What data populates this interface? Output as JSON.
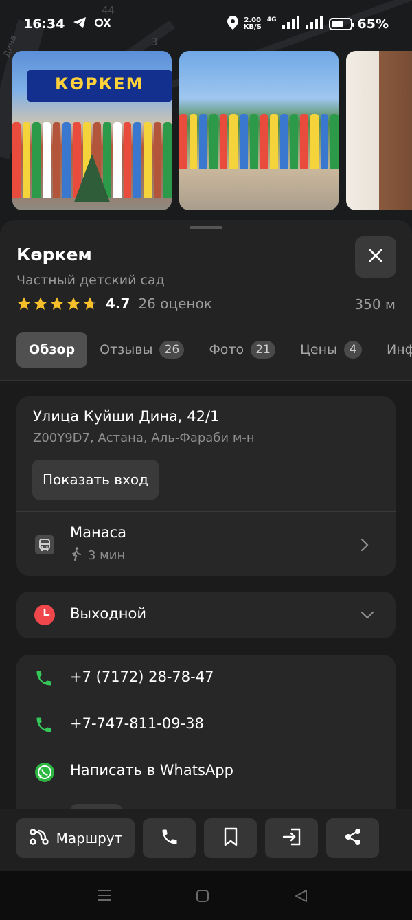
{
  "status_bar": {
    "time": "16:34",
    "net_speed_value": "2.00",
    "net_speed_unit": "KB/S",
    "net_type": "4G",
    "battery_percent": "65%",
    "battery_level": 0.65
  },
  "map": {
    "number_44": "44",
    "number_3": "3",
    "street_fragment": "Дина"
  },
  "photos": {
    "sign_text": "КӨРКЕМ"
  },
  "place": {
    "name": "Көркем",
    "category": "Частный детский сад",
    "rating": "4.7",
    "rating_stars": 4.7,
    "reviews_count": "26 оценок",
    "distance": "350 м"
  },
  "tabs": [
    {
      "label": "Обзор",
      "badge": ""
    },
    {
      "label": "Отзывы",
      "badge": "26"
    },
    {
      "label": "Фото",
      "badge": "21"
    },
    {
      "label": "Цены",
      "badge": "4"
    },
    {
      "label": "Инфо",
      "badge": ""
    }
  ],
  "address": {
    "street": "Улица Куйши Дина, 42/1",
    "details": "Z00Y9D7, Астана, Аль-Фараби м-н",
    "entry_button": "Показать вход"
  },
  "transit": {
    "stop_name": "Манаса",
    "walk_time": "3 мин"
  },
  "hours": {
    "status": "Выходной"
  },
  "contacts": {
    "phone1": "+7 (7172) 28-78-47",
    "phone2": "+7-747-811-09-38",
    "whatsapp": "Написать в WhatsApp"
  },
  "actions": {
    "route_label": "Маршрут"
  },
  "colors": {
    "accent_green": "#35c759",
    "accent_red": "#f0474c",
    "star": "#f7c02b",
    "whatsapp": "#2cb742"
  }
}
